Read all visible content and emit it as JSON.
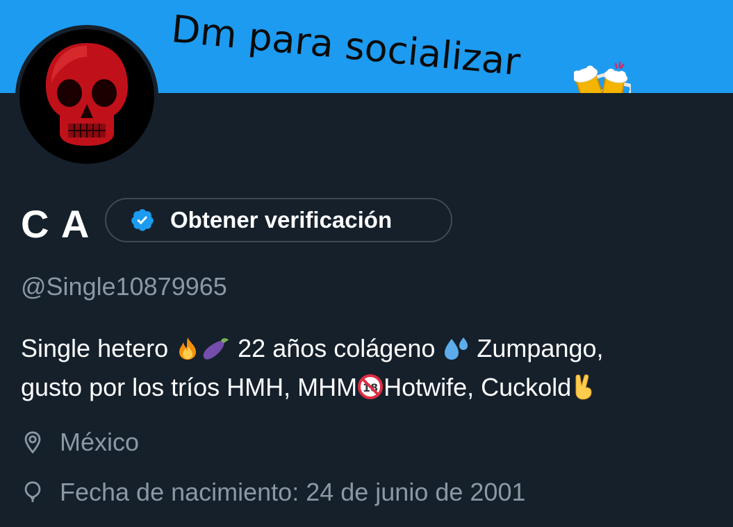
{
  "header": {
    "banner_text": "Dm para socializar"
  },
  "profile": {
    "name": "C A",
    "verify_label": "Obtener verificación",
    "handle": "@Single10879965",
    "bio": {
      "line1_a": "Single hetero ",
      "line1_b": " 22 años colágeno ",
      "line1_c": " Zumpango,",
      "line2_a": "gusto por los tríos HMH, MHM",
      "line2_b": "Hotwife, Cuckold"
    },
    "location": "México",
    "birth": "Fecha de nacimiento: 24 de junio de 2001"
  },
  "icons": {
    "avatar": "red-skull-avatar",
    "banner_emoji": "beer-mugs-icon",
    "verify": "verified-badge-icon",
    "location": "location-pin-icon",
    "birth": "balloon-icon",
    "bio_emojis": [
      "fire-icon",
      "eggplant-icon",
      "sweat-droplets-icon",
      "no-under-18-icon",
      "victory-hand-icon"
    ]
  },
  "colors": {
    "banner": "#1d9bf0",
    "background": "#15202b",
    "muted_text": "#8b98a5",
    "accent": "#1d9bf0"
  }
}
